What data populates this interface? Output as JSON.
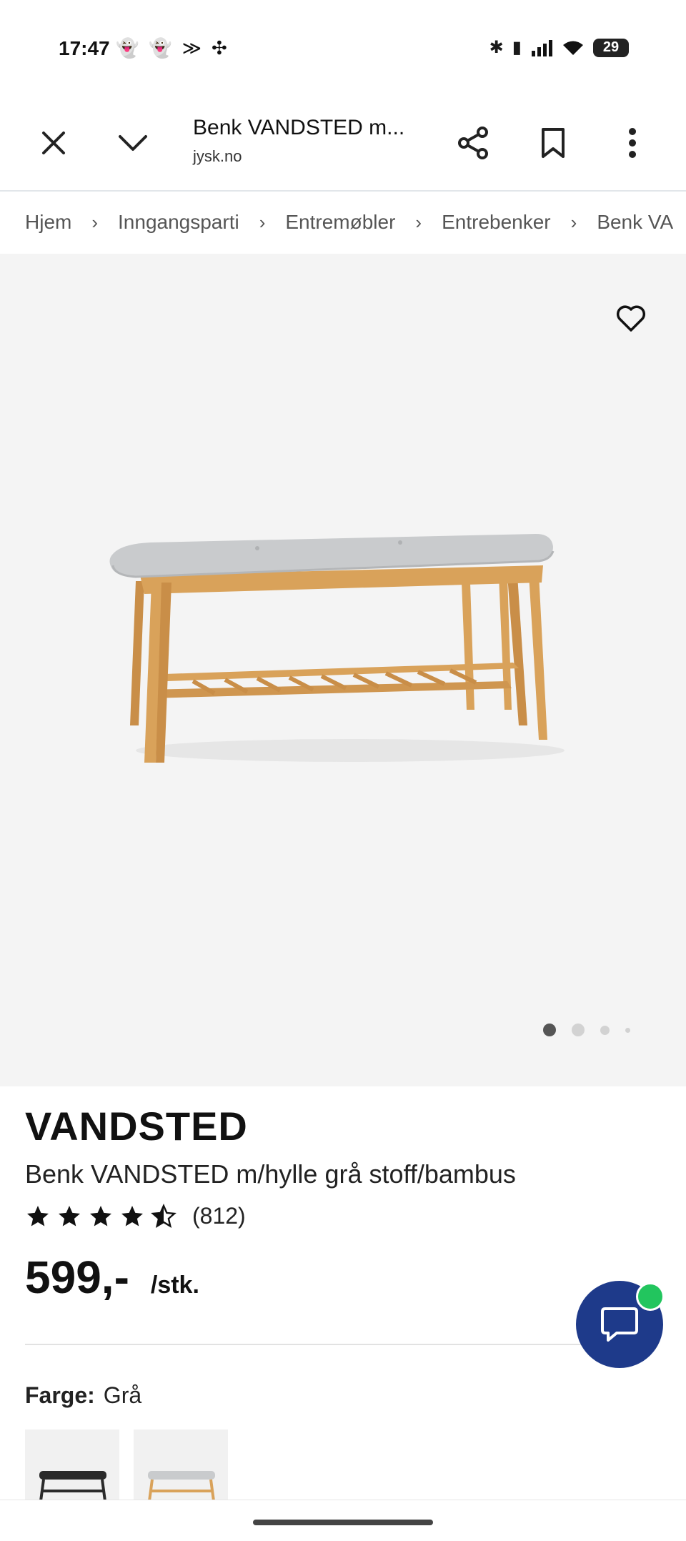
{
  "status_bar": {
    "time": "17:47",
    "battery": "29",
    "notification_icons": [
      "snapchat-icon",
      "snapchat-icon",
      "tidal-icon",
      "fan-icon"
    ],
    "system_icons": [
      "bluetooth-icon",
      "vibrate-icon",
      "signal-icon",
      "wifi-icon",
      "battery-icon"
    ]
  },
  "browser": {
    "page_title": "Benk VANDSTED m...",
    "domain": "jysk.no"
  },
  "breadcrumb": [
    "Hjem",
    "Inngangsparti",
    "Entremøbler",
    "Entrebenker",
    "Benk VA"
  ],
  "gallery": {
    "image_count": 4,
    "active_index": 0
  },
  "product": {
    "brand": "VANDSTED",
    "name": "Benk VANDSTED m/hylle grå stoff/bambus",
    "rating": 4.5,
    "review_count": "(812)",
    "price": "599,-",
    "unit": "/stk.",
    "color_label": "Farge:",
    "color_value": "Grå",
    "swatches": [
      "black",
      "grey"
    ]
  },
  "colors": {
    "chat_button": "#1e3a8a",
    "online_indicator": "#22c55e",
    "wood": "#d9a25a",
    "cushion": "#c9cbcd"
  }
}
